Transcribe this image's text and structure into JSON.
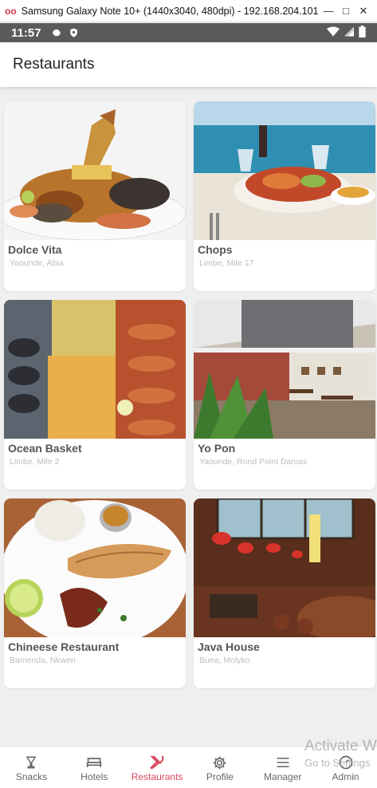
{
  "mirror": {
    "title": "Samsung Galaxy Note 10+ (1440x3040, 480dpi) - 192.168.204.101 - ...",
    "logo_icon": "scrcpy-logo-icon"
  },
  "status": {
    "time": "11:57"
  },
  "app_bar": {
    "title": "Restaurants"
  },
  "restaurants": [
    {
      "name": "Dolce Vita",
      "location": "Yaounde, Abia",
      "photo": "seafood-plate-photo"
    },
    {
      "name": "Chops",
      "location": "Limbe, Mile 17",
      "photo": "beach-seafood-table-photo"
    },
    {
      "name": "Ocean Basket",
      "location": "Limbe, Mile 2",
      "photo": "seafood-platter-photo"
    },
    {
      "name": "Yo Pon",
      "location": "Yaounde, Rond Point Damas",
      "photo": "restaurant-terrace-photo"
    },
    {
      "name": "Chineese Restaurant",
      "location": "Bamenda, Nkwen",
      "photo": "fish-rice-plate-photo"
    },
    {
      "name": "Java House",
      "location": "Buea, Molyko",
      "photo": "cafe-interior-photo"
    }
  ],
  "nav": [
    {
      "label": "Snacks",
      "icon": "glass-icon",
      "active": false
    },
    {
      "label": "Hotels",
      "icon": "bed-icon",
      "active": false
    },
    {
      "label": "Restaurants",
      "icon": "cutlery-icon",
      "active": true
    },
    {
      "label": "Profile",
      "icon": "gear-icon",
      "active": false
    },
    {
      "label": "Manager",
      "icon": "menu-lines-icon",
      "active": false
    },
    {
      "label": "Admin",
      "icon": "dashboard-icon",
      "active": false
    }
  ],
  "watermark": {
    "line1": "Activate W",
    "line2": "Go to Settings"
  },
  "colors": {
    "accent": "#d8485e",
    "background": "#efefef",
    "status_bar": "#5a5a5a"
  }
}
